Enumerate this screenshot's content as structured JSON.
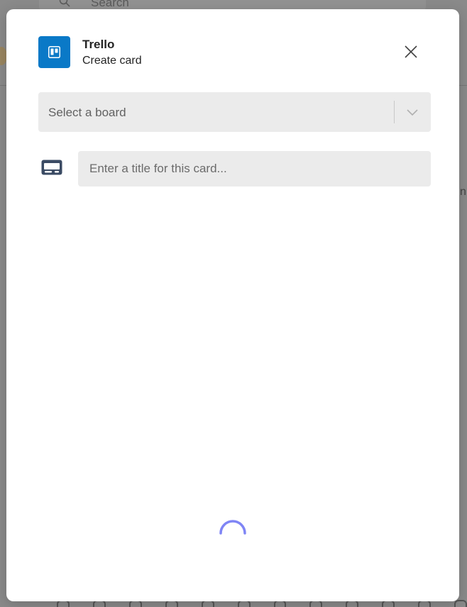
{
  "background": {
    "search_placeholder": "Search",
    "edge_text": "n",
    "search_icon": "search-icon"
  },
  "dialog": {
    "app_name": "Trello",
    "subtitle": "Create card",
    "logo_icon": "trello-logo-icon",
    "close_icon": "close-icon",
    "accent_color": "#0a79c7",
    "spinner_color": "#7f85f5"
  },
  "board_select": {
    "selected_label": "Select a board",
    "chevron_icon": "chevron-down-icon"
  },
  "card_title": {
    "value": "",
    "placeholder": "Enter a title for this card...",
    "icon": "card-icon"
  },
  "status": {
    "loading": true
  }
}
